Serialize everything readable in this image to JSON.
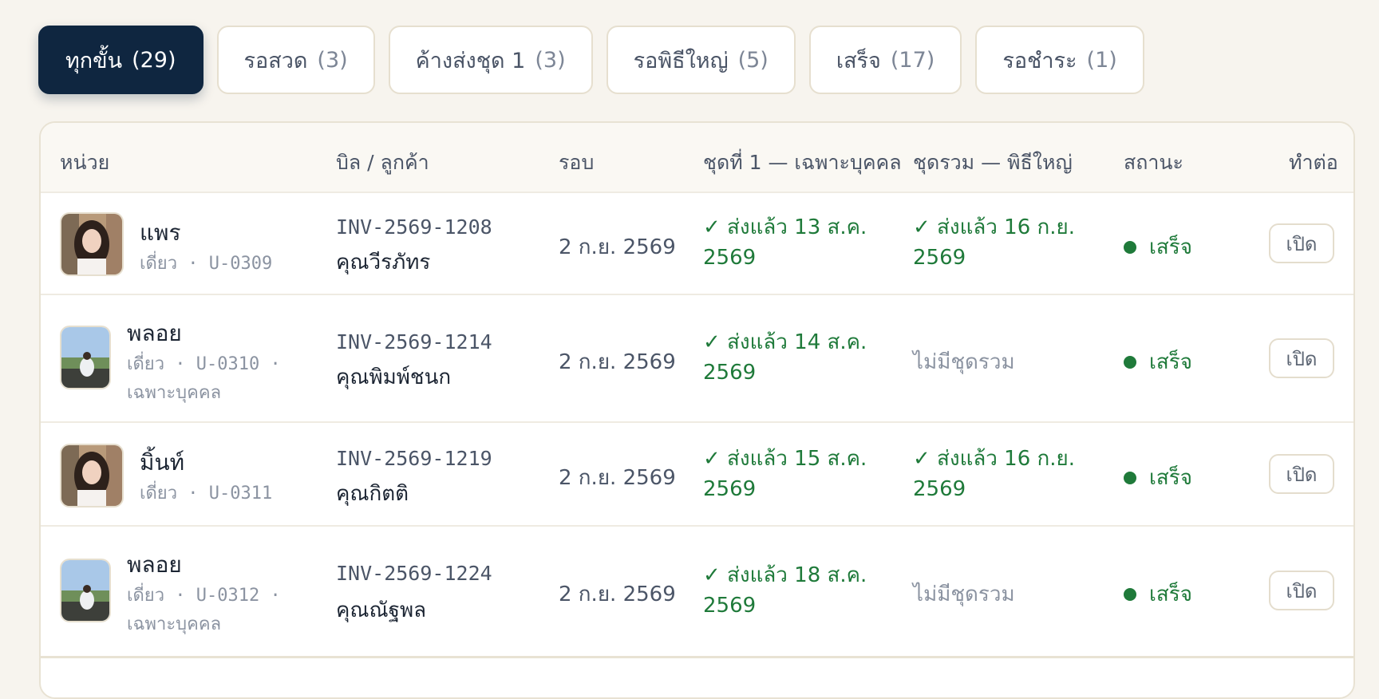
{
  "tabs": [
    {
      "label": "ทุกขั้น",
      "count": "(29)"
    },
    {
      "label": "รอสวด",
      "count": "(3)"
    },
    {
      "label": "ค้างส่งชุด 1",
      "count": "(3)"
    },
    {
      "label": "รอพิธีใหญ่",
      "count": "(5)"
    },
    {
      "label": "เสร็จ",
      "count": "(17)"
    },
    {
      "label": "รอชำระ",
      "count": "(1)"
    }
  ],
  "table": {
    "headers": {
      "unit": "หน่วย",
      "bill": "บิล / ลูกค้า",
      "round": "รอบ",
      "set1": "ชุดที่ 1 — เฉพาะบุคคล",
      "group": "ชุดรวม — พิธีใหญ่",
      "status": "สถานะ",
      "action": "ทำต่อ"
    },
    "rows": [
      {
        "name": "แพร",
        "sub": "เดี่ยว · U-0309",
        "sub2": "",
        "invoice": "INV-2569-1208",
        "customer": "คุณวีรภัทร",
        "round": "2 ก.ย. 2569",
        "set1_a": "✓ ส่งแล้ว 13 ส.ค.",
        "set1_b": "2569",
        "group_a": "✓ ส่งแล้ว 16 ก.ย.",
        "group_b": "2569",
        "status": "เสร็จ",
        "action": "เปิด"
      },
      {
        "name": "พลอย",
        "sub": "เดี่ยว · U-0310 ·",
        "sub2": "เฉพาะบุคคล",
        "invoice": "INV-2569-1214",
        "customer": "คุณพิมพ์ชนก",
        "round": "2 ก.ย. 2569",
        "set1_a": "✓ ส่งแล้ว 14 ส.ค.",
        "set1_b": "2569",
        "group_a": "ไม่มีชุดรวม",
        "group_b": "",
        "status": "เสร็จ",
        "action": "เปิด"
      },
      {
        "name": "มิ้นท์",
        "sub": "เดี่ยว · U-0311",
        "sub2": "",
        "invoice": "INV-2569-1219",
        "customer": "คุณกิตติ",
        "round": "2 ก.ย. 2569",
        "set1_a": "✓ ส่งแล้ว 15 ส.ค.",
        "set1_b": "2569",
        "group_a": "✓ ส่งแล้ว 16 ก.ย.",
        "group_b": "2569",
        "status": "เสร็จ",
        "action": "เปิด"
      },
      {
        "name": "พลอย",
        "sub": "เดี่ยว · U-0312 ·",
        "sub2": "เฉพาะบุคคล",
        "invoice": "INV-2569-1224",
        "customer": "คุณณัฐพล",
        "round": "2 ก.ย. 2569",
        "set1_a": "✓ ส่งแล้ว 18 ส.ค.",
        "set1_b": "2569",
        "group_a": "ไม่มีชุดรวม",
        "group_b": "",
        "status": "เสร็จ",
        "action": "เปิด"
      }
    ]
  },
  "colors": {
    "active_tab": "#0f2640",
    "success": "#1f7a3a",
    "muted": "#8b93a1",
    "background": "#f7f4ee"
  }
}
